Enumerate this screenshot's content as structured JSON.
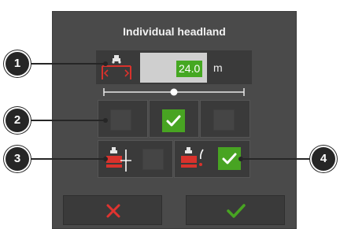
{
  "dialog": {
    "title": "Individual headland"
  },
  "headland_width": {
    "value": "24.0",
    "unit": "m",
    "icon": "headland-width-icon"
  },
  "slider": {
    "level_fraction": 0.5
  },
  "mode_selection": {
    "options": [
      {
        "name": "mode-option-1",
        "checked": false
      },
      {
        "name": "mode-option-2",
        "checked": true
      },
      {
        "name": "mode-option-3",
        "checked": false
      }
    ]
  },
  "headland_options": [
    {
      "name": "headland-option-machine-centered",
      "icon": "machine-center-line-icon",
      "checked": false
    },
    {
      "name": "headland-option-machine-edge",
      "icon": "machine-edge-line-icon",
      "checked": true
    }
  ],
  "callouts": [
    "1",
    "2",
    "3",
    "4"
  ],
  "buttons": {
    "cancel_icon": "cross-icon",
    "confirm_icon": "checkmark-icon"
  },
  "colors": {
    "panel": "#4a4a4a",
    "cell": "#3a3a3a",
    "accent_green": "#48a422",
    "cancel_red": "#e0332f",
    "value_highlight": "#45a822"
  }
}
